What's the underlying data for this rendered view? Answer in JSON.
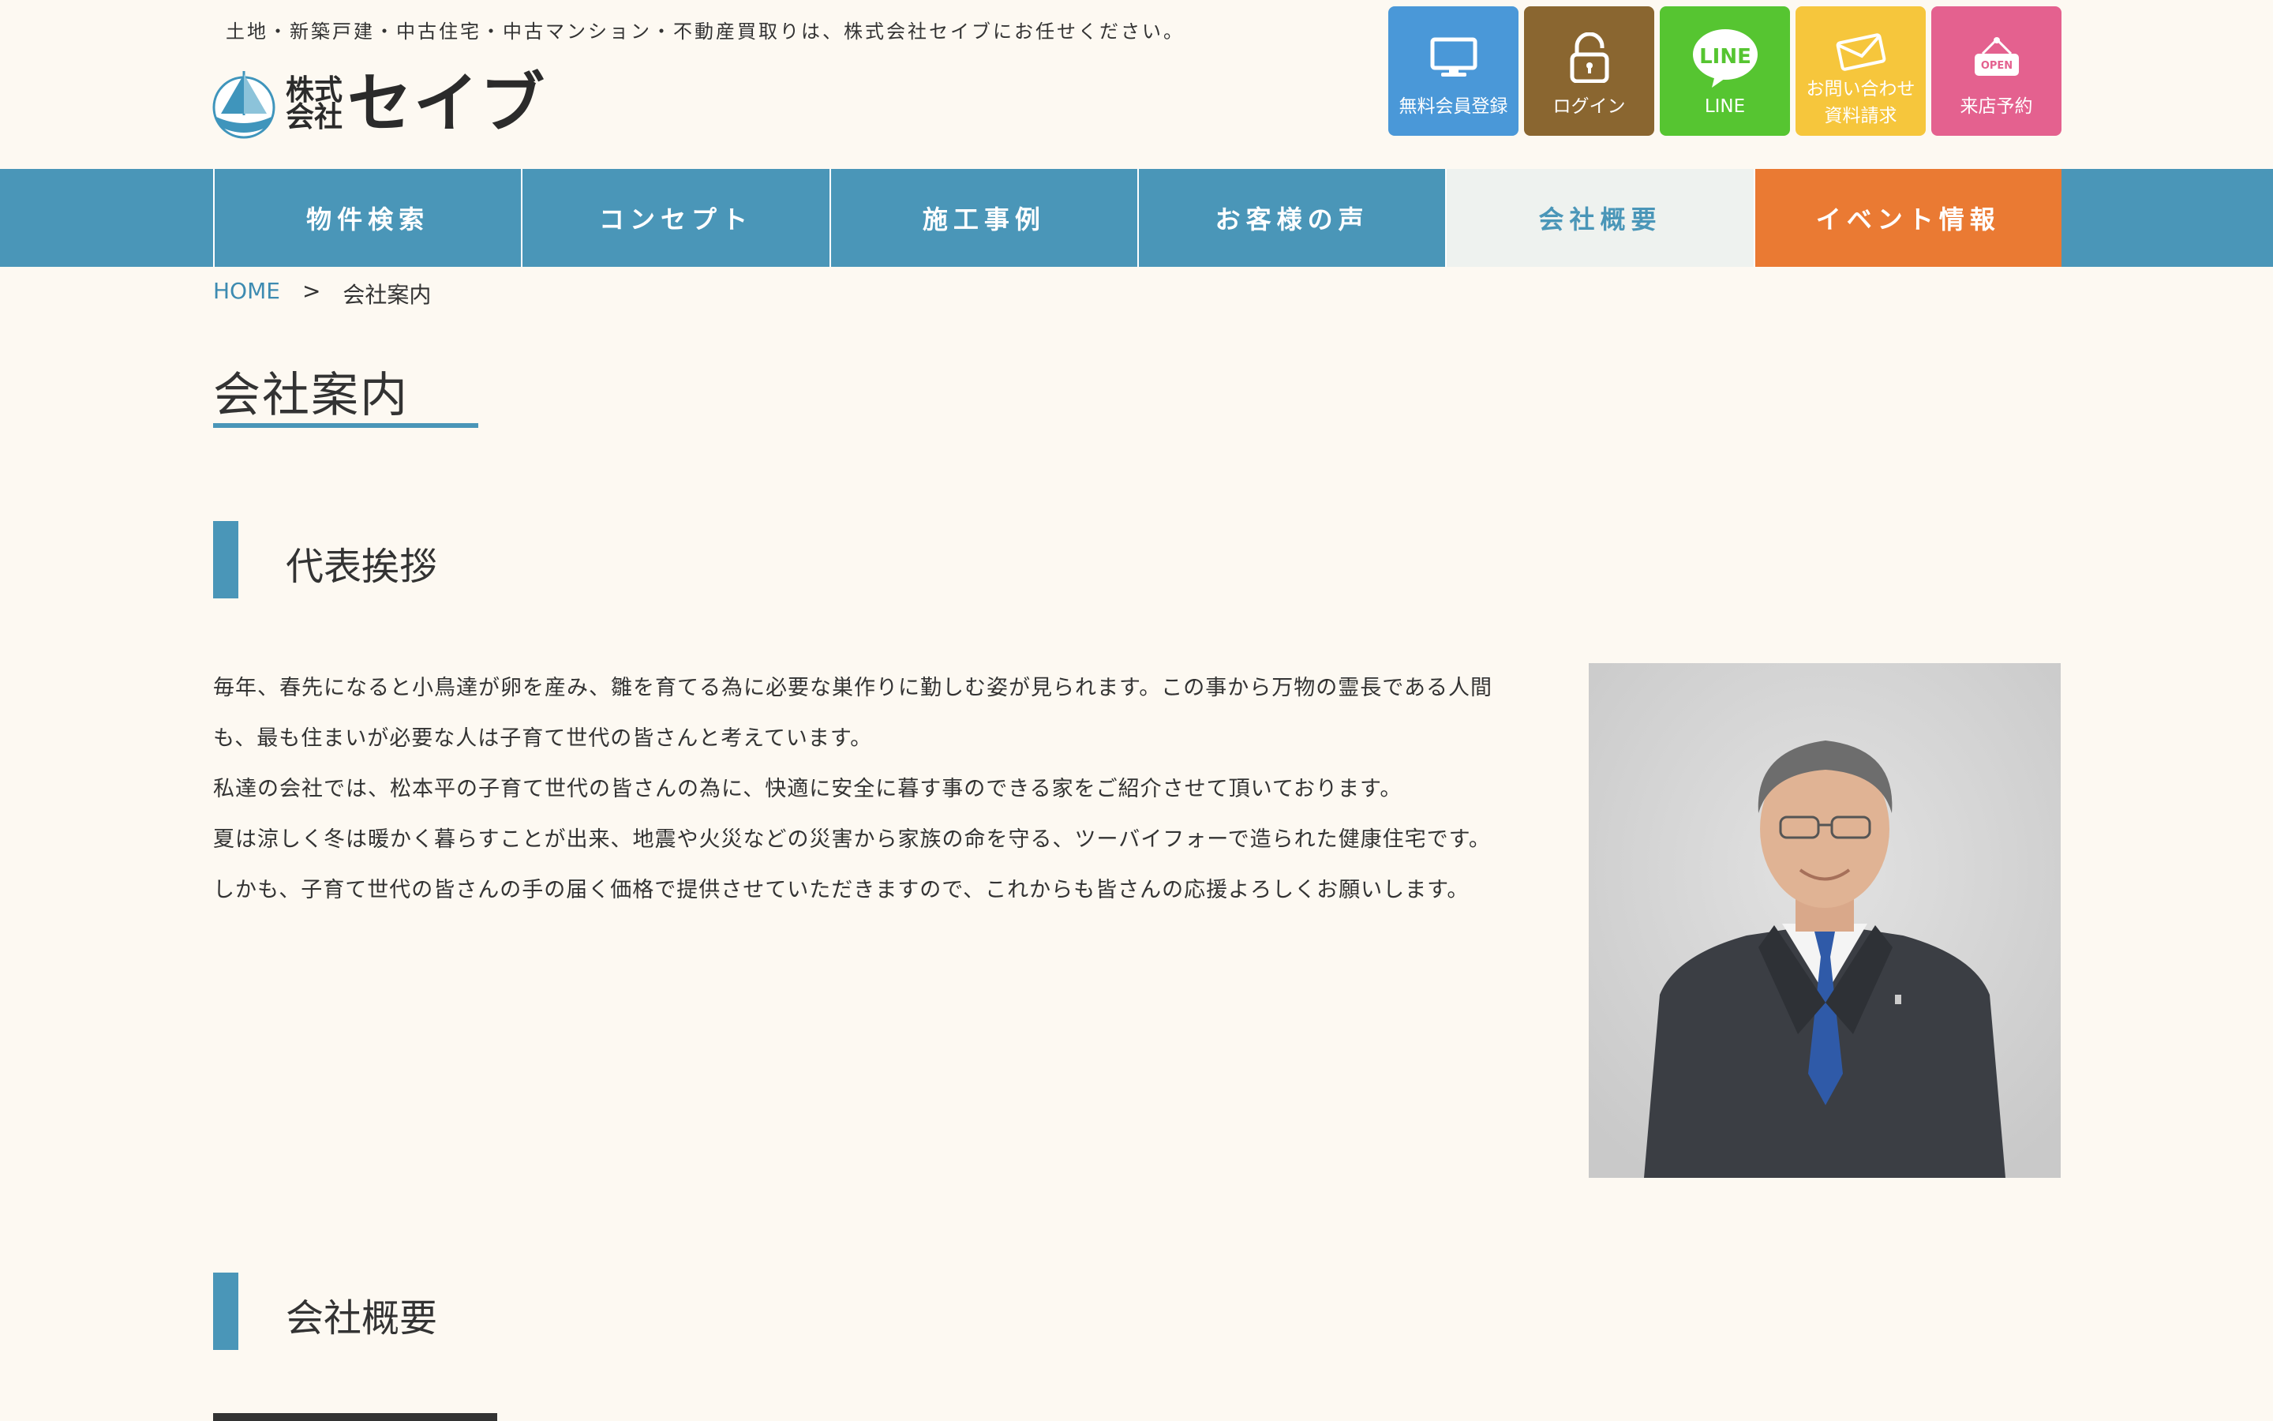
{
  "header": {
    "tagline": "土地・新築戸建・中古住宅・中古マンション・不動産買取りは、株式会社セイブにお任せください。",
    "logo_small_top": "株式",
    "logo_small_bottom": "会社",
    "logo_name": "セイブ",
    "buttons": [
      {
        "label": "無料会員登録",
        "icon": "monitor-icon",
        "color": "#4a98d8"
      },
      {
        "label": "ログイン",
        "icon": "unlock-icon",
        "color": "#8a6630"
      },
      {
        "label": "LINE",
        "icon": "line-icon",
        "color": "#56c531",
        "icon_text": "LINE"
      },
      {
        "label_line1": "お問い合わせ",
        "label_line2": "資料請求",
        "icon": "mail-icon",
        "color": "#f6c63c"
      },
      {
        "label": "来店予約",
        "icon": "open-sign-icon",
        "color": "#e4618f",
        "icon_text": "OPEN"
      }
    ]
  },
  "nav": {
    "items": [
      "物件検索",
      "コンセプト",
      "施工事例",
      "お客様の声",
      "会社概要",
      "イベント情報"
    ],
    "active_index": 4
  },
  "breadcrumb": {
    "home": "HOME",
    "separator": ">",
    "current": "会社案内"
  },
  "page_title": "会社案内",
  "sections": {
    "greeting_title": "代表挨拶",
    "greeting_lines": [
      "毎年、春先になると小鳥達が卵を産み、雛を育てる為に必要な巣作りに勤しむ姿が見られます。この事から万物の霊長である人間",
      "も、最も住まいが必要な人は子育て世代の皆さんと考えています。",
      "私達の会社では、松本平の子育て世代の皆さんの為に、快適に安全に暮す事のできる家をご紹介させて頂いております。",
      "夏は涼しく冬は暖かく暮らすことが出来、地震や火災などの災害から家族の命を守る、ツーバイフォーで造られた健康住宅です。",
      "しかも、子育て世代の皆さんの手の届く価格で提供させていただきますので、これからも皆さんの応援よろしくお願いします。"
    ],
    "company_title": "会社概要"
  },
  "colors": {
    "accent": "#4a96b8",
    "event": "#ea7a33",
    "background": "#fdf9f2"
  }
}
